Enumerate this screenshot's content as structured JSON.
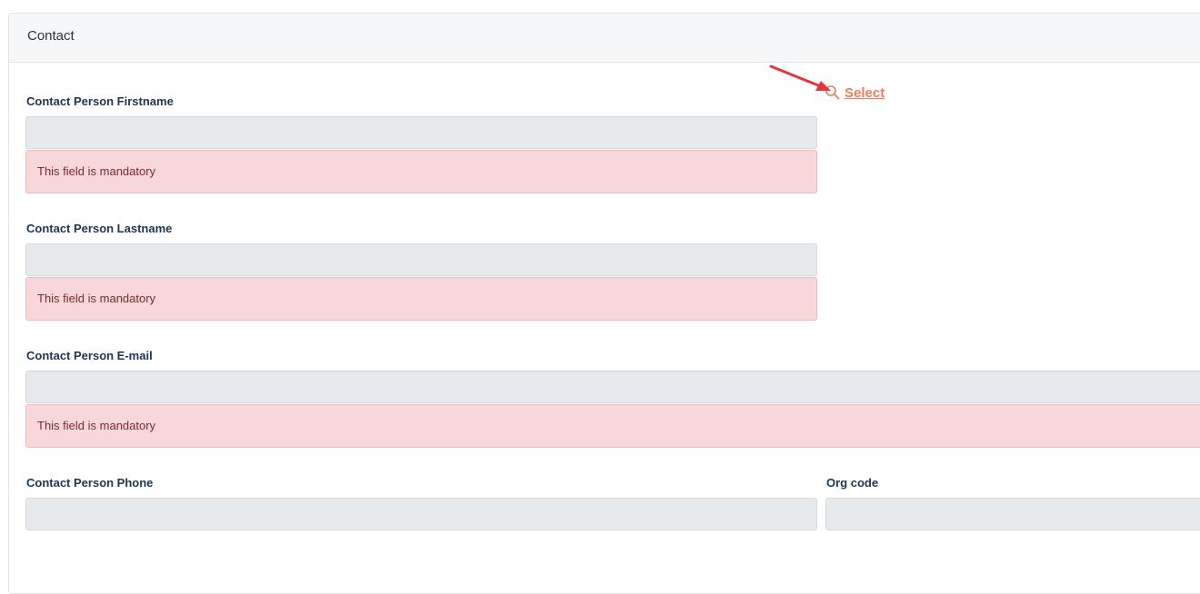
{
  "panel": {
    "title": "Contact"
  },
  "form": {
    "firstname_label": "Contact Person Firstname",
    "lastname_label": "Contact Person Lastname",
    "email_label": "Contact Person E-mail",
    "phone_label": "Contact Person Phone",
    "orgcode_label": "Org code",
    "firstname_error": "This field is mandatory",
    "lastname_error": "This field is mandatory",
    "email_error": "This field is mandatory"
  },
  "select_link": {
    "label": "Select",
    "icon": "search-icon"
  },
  "colors": {
    "link": "#ef7d5b",
    "error_bg": "#f8d7da",
    "input_bg": "#e7eaed",
    "annotation_arrow": "#e0383b"
  }
}
